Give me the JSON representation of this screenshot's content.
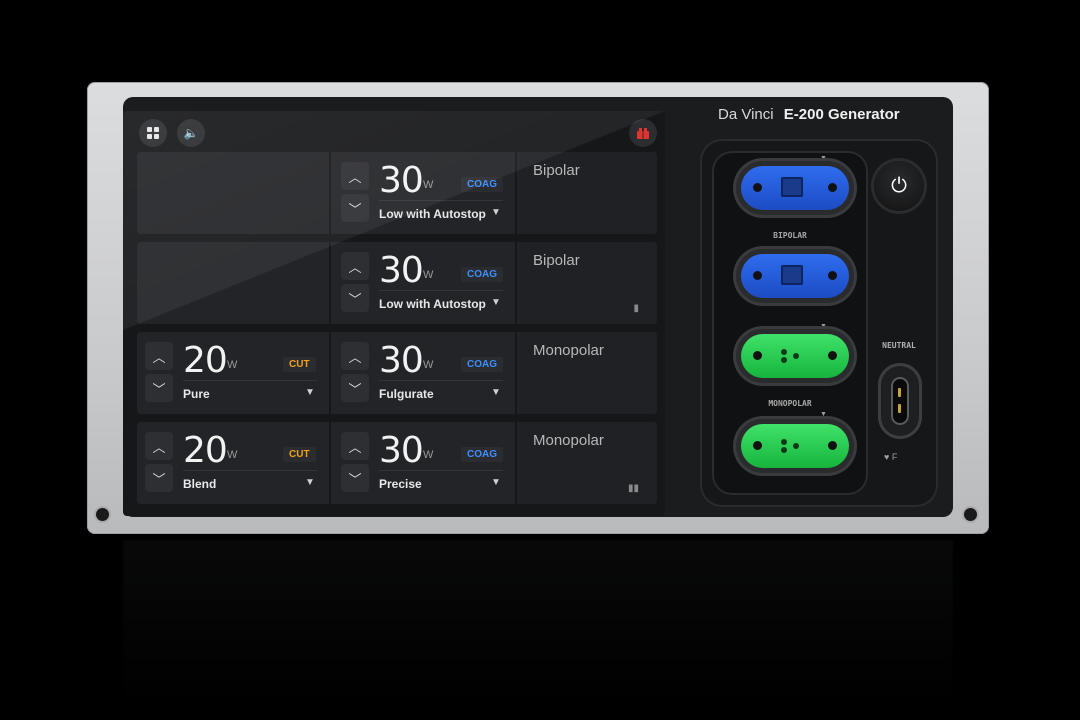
{
  "brand": {
    "prefix": "Da Vinci",
    "model": "E-200 Generator"
  },
  "topbar": {
    "grid_icon": "grid-icon",
    "sound_icon": "speaker-icon",
    "alert_icon": "alert-indicator-icon"
  },
  "rows": [
    {
      "left": null,
      "right": {
        "value": "30",
        "unit": "W",
        "badge": "COAG",
        "mode": "Low with Autostop"
      },
      "type": "Bipolar"
    },
    {
      "left": null,
      "right": {
        "value": "30",
        "unit": "W",
        "badge": "COAG",
        "mode": "Low with Autostop"
      },
      "type": "Bipolar"
    },
    {
      "left": {
        "value": "20",
        "unit": "W",
        "badge": "CUT",
        "mode": "Pure"
      },
      "right": {
        "value": "30",
        "unit": "W",
        "badge": "COAG",
        "mode": "Fulgurate"
      },
      "type": "Monopolar"
    },
    {
      "left": {
        "value": "20",
        "unit": "W",
        "badge": "CUT",
        "mode": "Blend"
      },
      "right": {
        "value": "30",
        "unit": "W",
        "badge": "COAG",
        "mode": "Precise"
      },
      "type": "Monopolar"
    }
  ],
  "ports": {
    "bipolar_label": "BIPOLAR",
    "monopolar_label": "MONOPOLAR",
    "neutral_label": "NEUTRAL",
    "neutral_icons": "♥ F"
  },
  "colors": {
    "coag": "#3d8fff",
    "cut": "#f0a21a",
    "bipolar_port": "#2f6df0",
    "monopolar_port": "#3fe26a"
  }
}
